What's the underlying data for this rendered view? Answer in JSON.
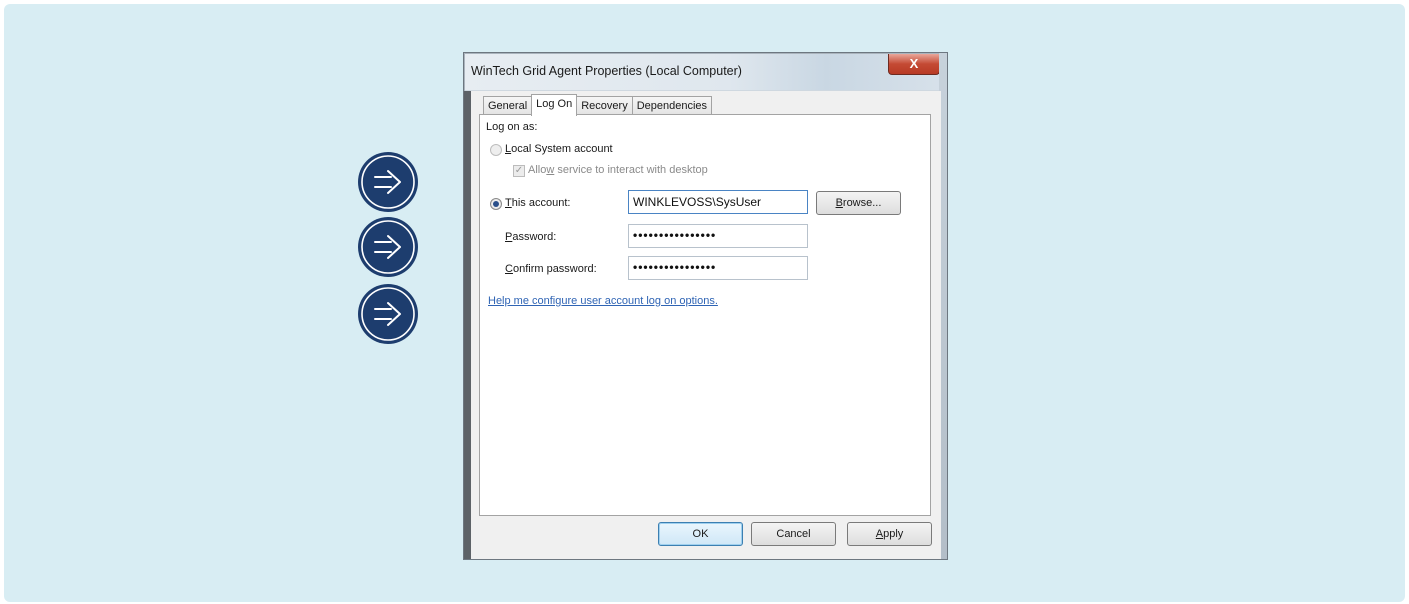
{
  "window": {
    "title": "WinTech Grid Agent Properties (Local Computer)",
    "close_glyph": "X"
  },
  "tabs": [
    "General",
    "Log On",
    "Recovery",
    "Dependencies"
  ],
  "logon": {
    "heading": "Log on as:",
    "local_system_label_accel": "L",
    "local_system_label_rest": "ocal System account",
    "allow_label_pre": "Allo",
    "allow_label_accel": "w",
    "allow_label_post": " service to interact with desktop",
    "this_account_accel": "T",
    "this_account_rest": "his account:",
    "account_value": "WINKLEVOSS\\SysUser",
    "password_accel": "P",
    "password_rest": "assword:",
    "password_value": "••••••••••••••••",
    "confirm_accel": "C",
    "confirm_rest": "onfirm password:",
    "confirm_value": "••••••••••••••••",
    "help_link": "Help me configure user account log on options."
  },
  "buttons": {
    "browse_accel": "B",
    "browse_rest": "rowse...",
    "ok": "OK",
    "cancel": "Cancel",
    "apply_accel": "A",
    "apply_rest": "pply"
  },
  "colors": {
    "backdrop": "#d8edf3",
    "badge": "#1d3d6e",
    "link": "#2f64b4"
  },
  "icons": [
    "arrow-right-icon",
    "arrow-right-icon",
    "arrow-right-icon"
  ]
}
